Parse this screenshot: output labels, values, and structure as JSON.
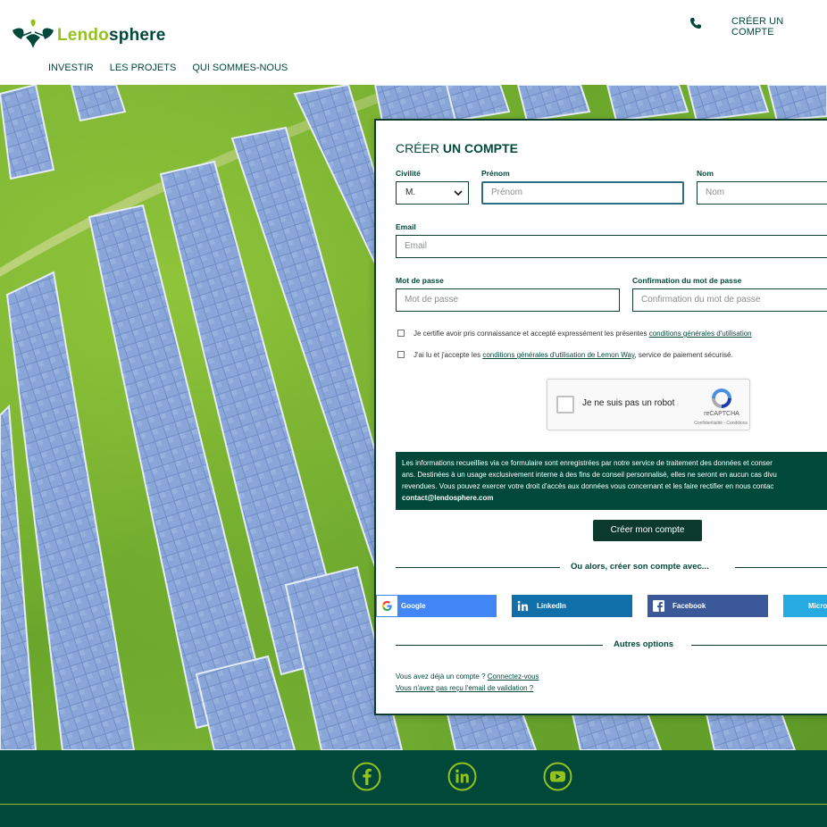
{
  "header": {
    "logo_part1": "Lendo",
    "logo_part2": "sphere",
    "create_account": "CRÉER UN COMPTE",
    "nav": [
      "INVESTIR",
      "LES PROJETS",
      "QUI SOMMES-NOUS"
    ]
  },
  "form": {
    "title_light": "CRÉER ",
    "title_bold": "UN COMPTE",
    "civility_label": "Civilité",
    "civility_value": "M.",
    "firstname_label": "Prénom",
    "firstname_placeholder": "Prénom",
    "lastname_label": "Nom",
    "lastname_placeholder": "Nom",
    "email_label": "Email",
    "email_placeholder": "Email",
    "password_label": "Mot de passe",
    "password_placeholder": "Mot de passe",
    "confirm_label": "Confirmation du mot de passe",
    "confirm_placeholder": "Confirmation du mot de passe",
    "cgu_text": "Je certifie avoir pris connaissance et accepté expressément les présentes ",
    "cgu_link": "conditions générales d'utilisation",
    "lemonway_text_a": "J'ai lu et j'accepte les ",
    "lemonway_link": "conditions générales d'utilisation de Lemon Way",
    "lemonway_text_b": ", service de paiement sécurisé.",
    "recaptcha_label": "Je ne suis pas un robot",
    "recaptcha_brand": "reCAPTCHA",
    "recaptcha_terms": "Confidentialité - Conditions",
    "notice_line1": "Les informations recueillies via ce formulaire sont enregistrées par notre service de traitement des données et conser",
    "notice_line2": "ans. Destinées à un usage exclusivement interne à des fins de conseil personnalisé, elles ne seront en aucun cas divu",
    "notice_line3": "revendues. Vous pouvez exercer votre droit d'accès aux données vous concernant et les faire rectifier en nous contac",
    "notice_email": "contact@lendosphere.com",
    "submit_label": "Créer mon compte",
    "or_text": "Ou alors, créer son compte avec...",
    "social": {
      "google": "Google",
      "linkedin": "LinkedIn",
      "facebook": "Facebook",
      "microsoft": "Micro"
    },
    "other_options": "Autres options",
    "already_text": "Vous avez déjà un compte ? ",
    "login_link": "Connectez-vous",
    "no_email_link": "Vous n'avez pas reçu l'email de validation ?"
  },
  "colors": {
    "brand_green": "#00483a",
    "accent_lime": "#95c11f"
  }
}
